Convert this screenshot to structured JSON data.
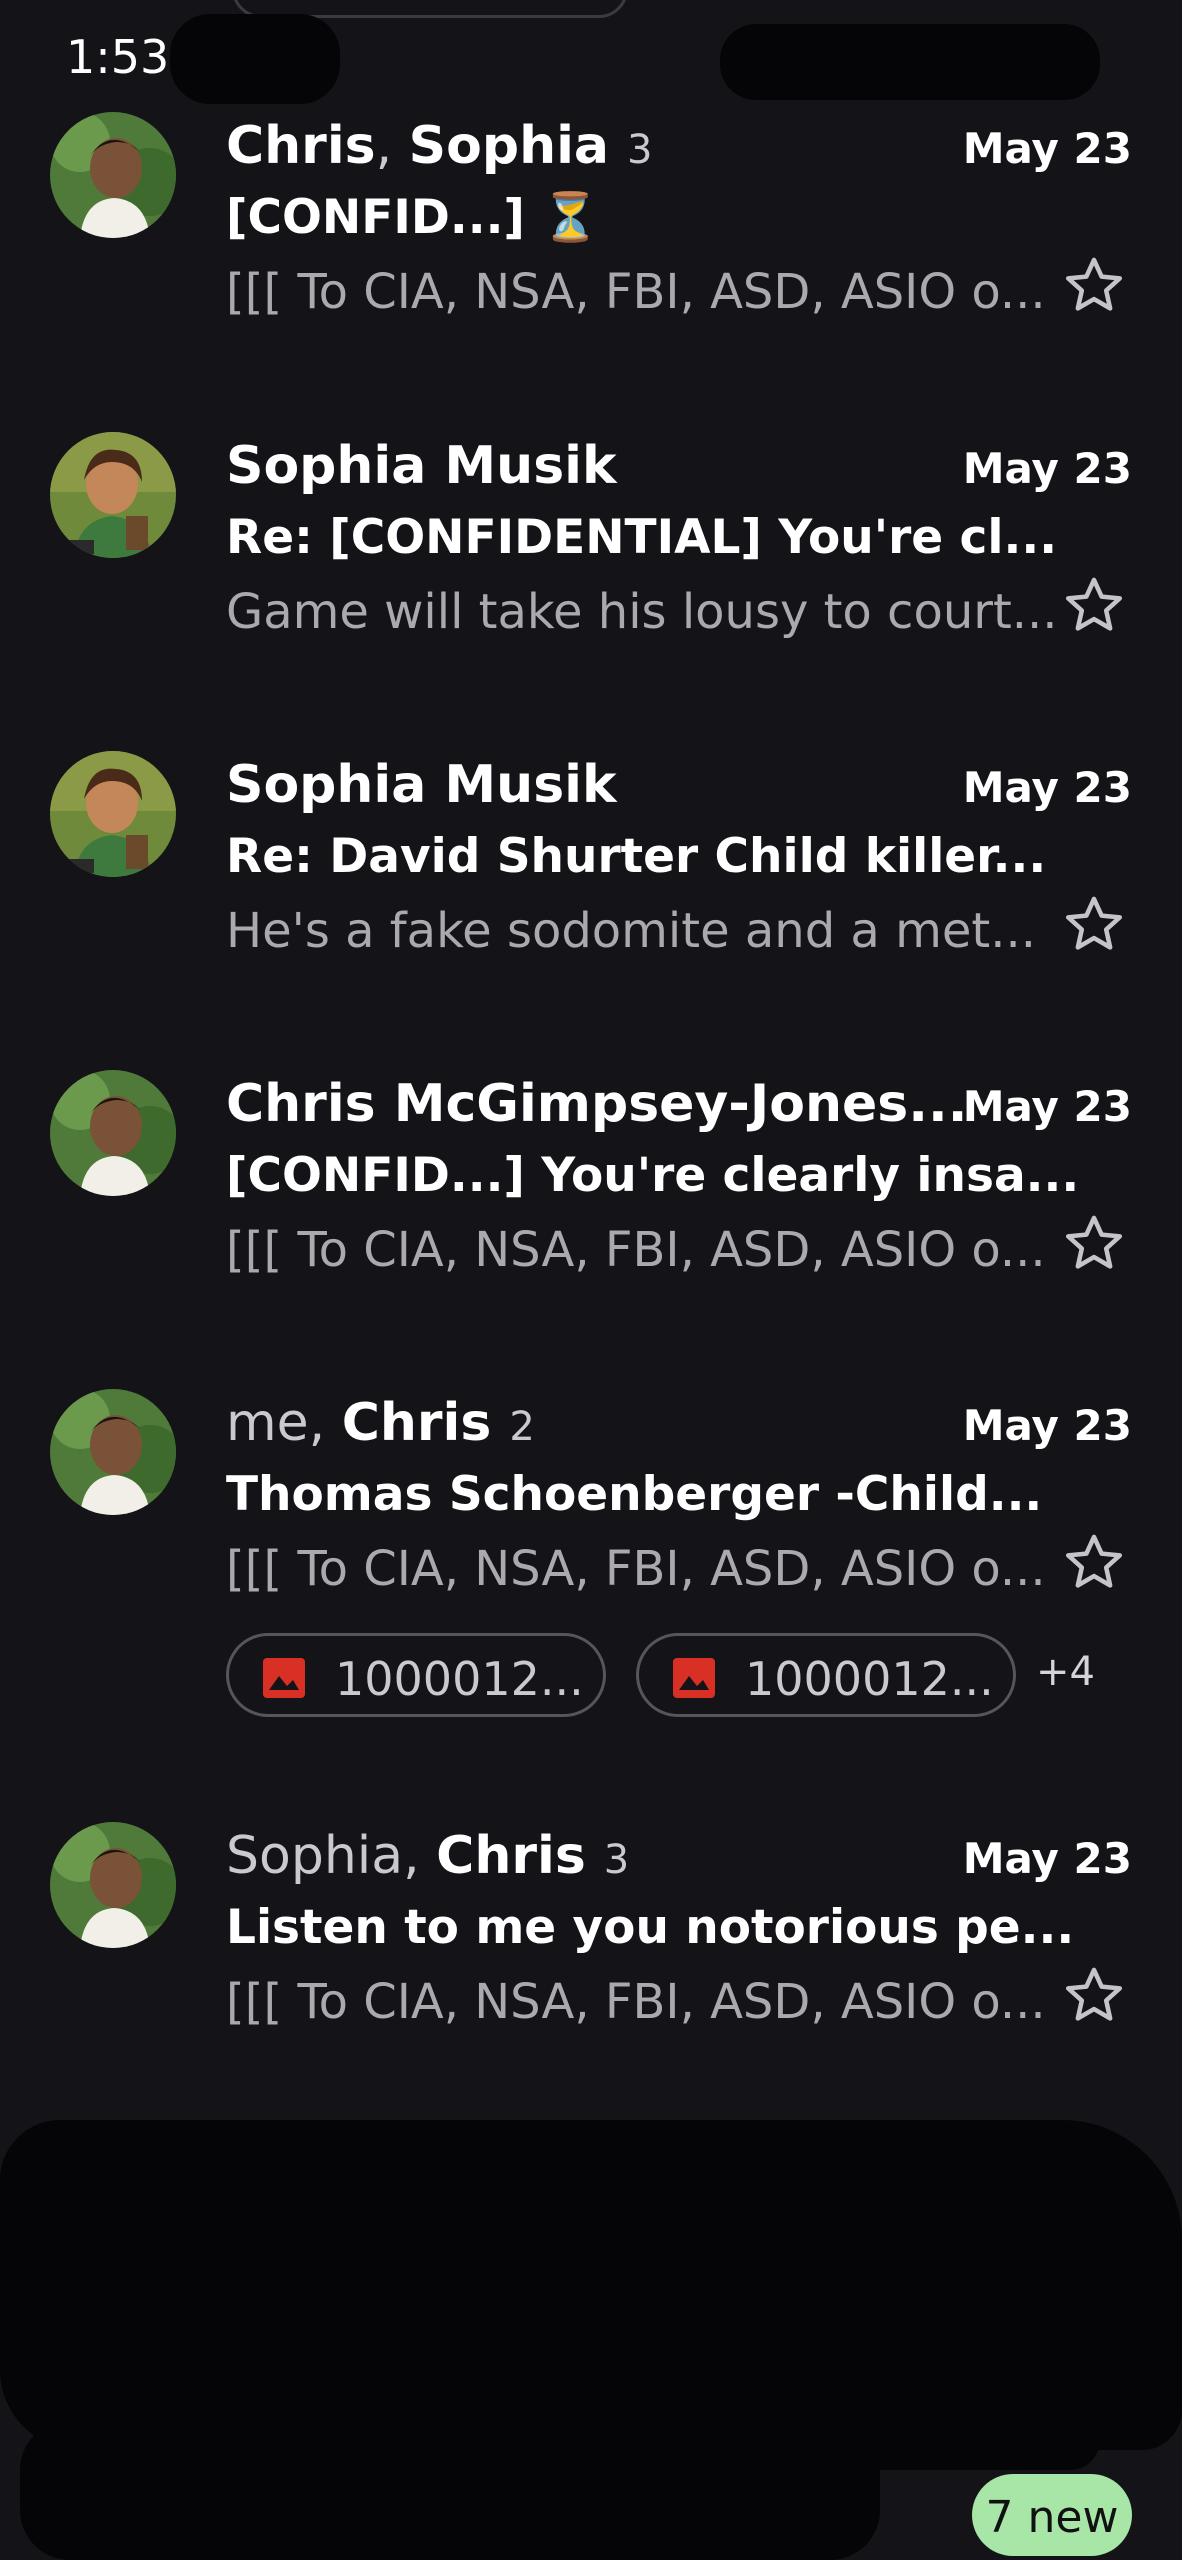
{
  "status_bar": {
    "time": "1:53"
  },
  "threads": [
    {
      "sender_normal_prefix": "",
      "sender_bold": "Chris",
      "sender_sep": ", ",
      "sender_bold2": "Sophia",
      "count": "3",
      "date": "May 23",
      "subject": "[CONFID...] ⏳",
      "snippet": "[[[ To CIA, NSA, FBI, ASD, ASIO o...",
      "avatar": "man-photo"
    },
    {
      "sender_bold": "Sophia Musik",
      "date": "May 23",
      "subject": "Re: [CONFIDENTIAL] You're cl...",
      "snippet": "Game will take his lousy to court...",
      "avatar": "painting-portrait"
    },
    {
      "sender_bold": "Sophia Musik",
      "date": "May 23",
      "subject": "Re: David Shurter Child killer...",
      "snippet": "He's a fake sodomite and a met...",
      "avatar": "painting-portrait"
    },
    {
      "sender_bold": "Chris McGimpsey-Jones...",
      "date": "May 23",
      "subject": "[CONFID...] You're clearly insa...",
      "snippet": "[[[ To CIA, NSA, FBI, ASD, ASIO o...",
      "avatar": "man-photo"
    },
    {
      "sender_normal_prefix": "me, ",
      "sender_bold": "Chris",
      "count": "2",
      "date": "May 23",
      "subject": "Thomas Schoenberger -Child...",
      "snippet": "[[[ To CIA, NSA, FBI, ASD, ASIO o...",
      "avatar": "man-photo",
      "attachments": [
        "1000012...",
        "1000012..."
      ],
      "more_attachments": "+4"
    },
    {
      "sender_normal_prefix": "Sophia, ",
      "sender_bold": "Chris",
      "count": "3",
      "date": "May 23",
      "subject": "Listen to me you notorious pe...",
      "snippet": "[[[ To CIA, NSA, FBI, ASD, ASIO o...",
      "avatar": "man-photo"
    }
  ],
  "new_pill": "7 new",
  "colors": {
    "background": "#131318",
    "attachment_icon": "#d93025",
    "new_pill": "#a8e6a8"
  }
}
